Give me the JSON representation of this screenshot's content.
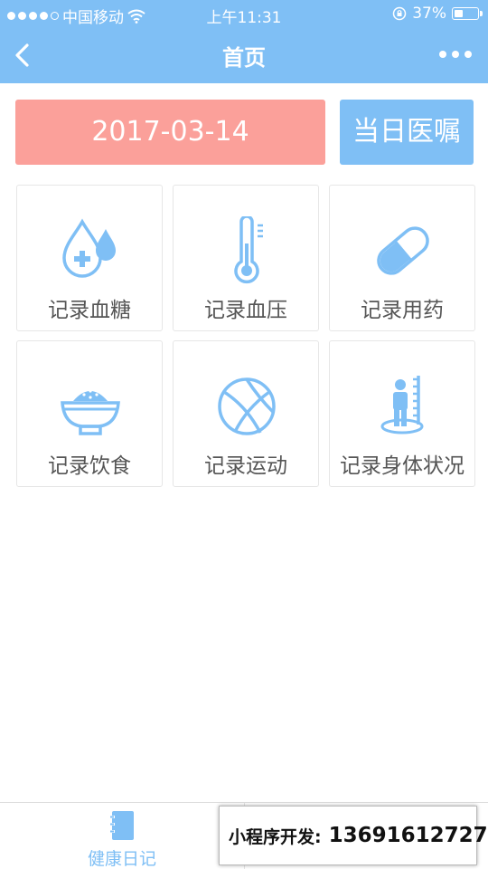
{
  "status_bar": {
    "carrier": "中国移动",
    "time": "上午11:31",
    "battery_percent": "37%"
  },
  "nav": {
    "title": "首页"
  },
  "date_button": {
    "label": "2017-03-14"
  },
  "advice_button": {
    "label": "当日医嘱"
  },
  "tiles": [
    {
      "label": "记录血糖",
      "icon": "blood-drop-icon"
    },
    {
      "label": "记录血压",
      "icon": "thermometer-icon"
    },
    {
      "label": "记录用药",
      "icon": "pill-capsule-icon"
    },
    {
      "label": "记录饮食",
      "icon": "rice-bowl-icon"
    },
    {
      "label": "记录运动",
      "icon": "basketball-icon"
    },
    {
      "label": "记录身体状况",
      "icon": "body-height-icon"
    }
  ],
  "tab_bar": {
    "tab1_label": "健康日记"
  },
  "promo": {
    "label": "小程序开发:",
    "phone": "13691612727"
  },
  "colors": {
    "primary": "#7fbff5",
    "date_bg": "#fba09a",
    "icon": "#7fbff5",
    "tile_border": "#e6e6e6"
  }
}
